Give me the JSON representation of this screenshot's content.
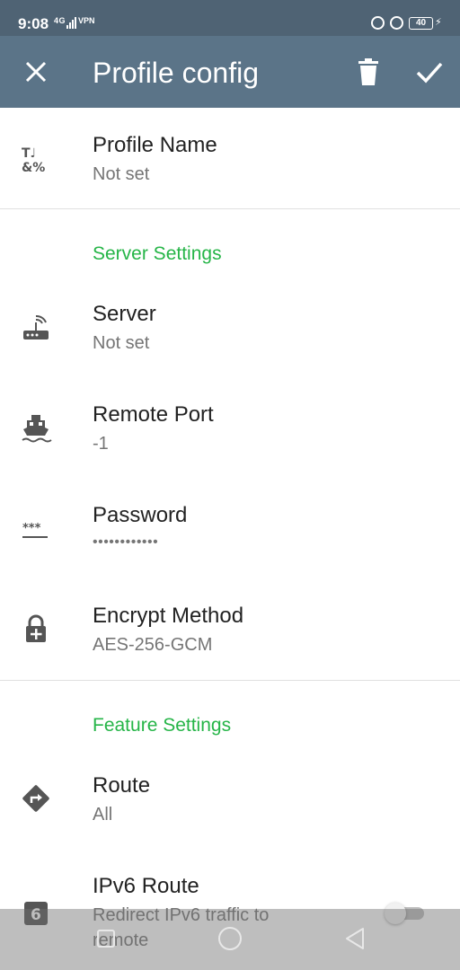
{
  "status_bar": {
    "time": "9:08",
    "signal": "4G",
    "vpn": "VPN",
    "battery": "40",
    "icons": [
      "signal-icon",
      "vpn-icon",
      "sync-icon",
      "lock-rotation-icon",
      "battery-icon",
      "charging-icon"
    ]
  },
  "app_bar": {
    "title": "Profile config",
    "close_icon": "close-icon",
    "delete_icon": "trash-icon",
    "save_icon": "check-icon"
  },
  "profile": {
    "name_label": "Profile Name",
    "name_value": "Not set"
  },
  "server_settings": {
    "header": "Server Settings",
    "items": [
      {
        "label": "Server",
        "value": "Not set",
        "icon": "router-icon"
      },
      {
        "label": "Remote Port",
        "value": "-1",
        "icon": "ferry-icon"
      },
      {
        "label": "Password",
        "value": "••••••••••••",
        "icon": "password-icon"
      },
      {
        "label": "Encrypt Method",
        "value": "AES-256-GCM",
        "icon": "lock-add-icon"
      }
    ]
  },
  "feature_settings": {
    "header": "Feature Settings",
    "route": {
      "label": "Route",
      "value": "All",
      "icon": "directions-icon"
    },
    "ipv6": {
      "label": "IPv6 Route",
      "desc_line1": "Redirect IPv6 traffic to",
      "desc_line2": "remote",
      "icon": "ipv6-icon",
      "enabled": false
    }
  },
  "colors": {
    "status_bar": "#4f6374",
    "app_bar": "#5b7488",
    "accent": "#26b548",
    "title_text": "#222222",
    "subtitle_text": "#757575"
  },
  "nav_bar": {
    "icons": [
      "recents-icon",
      "home-icon",
      "back-icon"
    ]
  }
}
